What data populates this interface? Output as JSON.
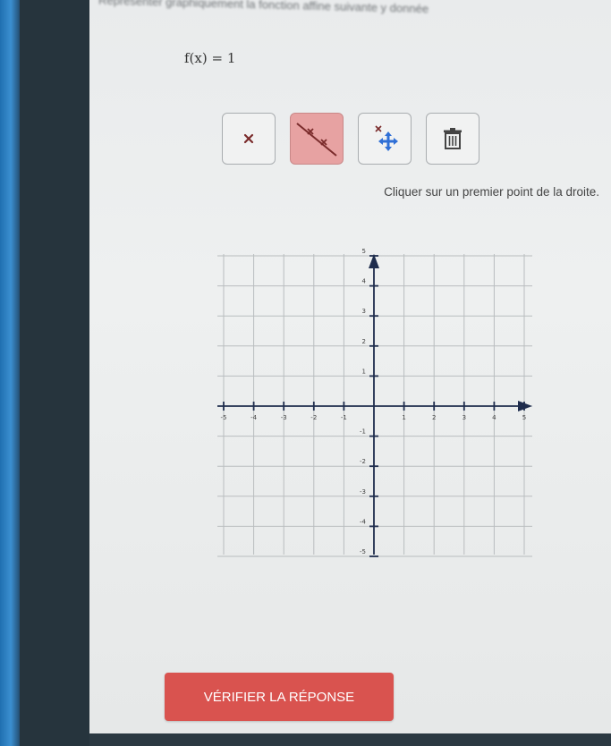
{
  "header": {
    "text": "Représenter graphiquement la fonction affine suivante y donnée"
  },
  "function_label": "f(x) = 1",
  "toolbar": {
    "buttons": [
      {
        "name": "point-tool",
        "icon": "x-mark-icon",
        "active": false
      },
      {
        "name": "line-tool",
        "icon": "line-icon",
        "active": true
      },
      {
        "name": "move-tool",
        "icon": "move-arrows-icon",
        "active": false
      },
      {
        "name": "delete-tool",
        "icon": "trash-icon",
        "active": false
      }
    ]
  },
  "instruction": "Cliquer sur un premier point de la droite.",
  "graph": {
    "x_range": [
      -5,
      5
    ],
    "y_range": [
      -5,
      5
    ],
    "x_ticks": [
      "-5",
      "-4",
      "-3",
      "-2",
      "-1",
      "1",
      "2",
      "3",
      "4",
      "5"
    ],
    "y_ticks": [
      "5",
      "4",
      "3",
      "2",
      "1",
      "-1",
      "-2",
      "-3",
      "-4",
      "-5"
    ]
  },
  "verify_button": {
    "label": "VÉRIFIER LA RÉPONSE"
  },
  "colors": {
    "active_tool": "#e7a2a2",
    "verify_button": "#d9534f",
    "axis": "#1f2d4d",
    "grid": "#b9bdbf"
  }
}
